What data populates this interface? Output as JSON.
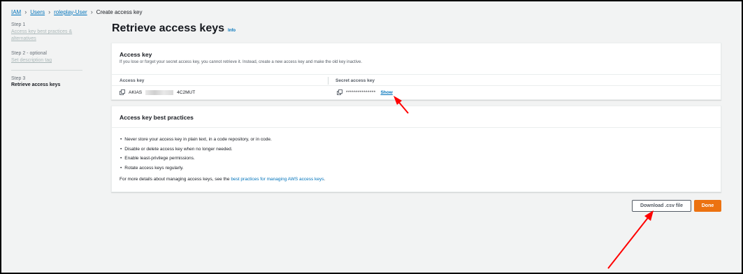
{
  "breadcrumb": {
    "items": [
      "IAM",
      "Users",
      "roleplay-User",
      "Create access key"
    ]
  },
  "sidebar": {
    "steps": [
      {
        "label": "Step 1",
        "title": "Access key best practices & alternatives"
      },
      {
        "label": "Step 2 - optional",
        "title": "Set description tag"
      },
      {
        "label": "Step 3",
        "title": "Retrieve access keys"
      }
    ]
  },
  "main": {
    "title": "Retrieve access keys",
    "info_link": "Info",
    "access_key_panel": {
      "heading": "Access key",
      "description": "If you lose or forget your secret access key, you cannot retrieve it. Instead, create a new access key and make the old key inactive.",
      "columns": [
        "Access key",
        "Secret access key"
      ],
      "access_key_prefix": "AKIAS",
      "access_key_suffix": "4C2MUT",
      "secret_masked": "***************",
      "show_label": "Show"
    },
    "best_practices_panel": {
      "heading": "Access key best practices",
      "items": [
        "Never store your access key in plain text, in a code repository, or in code.",
        "Disable or delete access key when no longer needed.",
        "Enable least-privilege permissions.",
        "Rotate access keys regularly."
      ],
      "more_prefix": "For more details about managing access keys, see the ",
      "more_link": "best practices for managing AWS access keys",
      "more_suffix": "."
    }
  },
  "actions": {
    "download_label": "Download .csv file",
    "done_label": "Done"
  },
  "colors": {
    "accent_orange": "#ec7211",
    "link_blue": "#0073bb",
    "annotation_red": "#ff0000"
  }
}
